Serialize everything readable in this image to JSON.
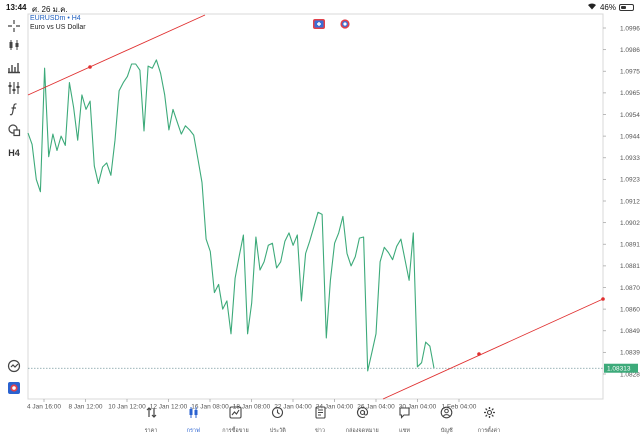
{
  "status_bar": {
    "time": "13:44",
    "date": "ศ. 26 ม.ค.",
    "battery_text": "46%",
    "battery_level": 0.46
  },
  "left_toolbar": [
    {
      "name": "crosshair-icon"
    },
    {
      "name": "candlestick-type-icon"
    },
    {
      "name": "bar-chart-icon"
    },
    {
      "name": "indicators-icon"
    },
    {
      "name": "function-icon"
    },
    {
      "name": "shapes-icon"
    },
    {
      "name": "timeframe-label",
      "text": "H4"
    }
  ],
  "chart_header": {
    "symbol": "EURUSDm",
    "timeframe": "H4",
    "symbol_line": "EURUSDm • H4",
    "description": "Euro vs US Dollar"
  },
  "trade_buttons": [
    {
      "name": "sell-flag-icon",
      "color": "#e0404a"
    },
    {
      "name": "buy-flag-icon",
      "color": "#3b6fd6"
    }
  ],
  "chart_data": {
    "type": "line",
    "title": "",
    "y_ticks": [
      "1.09965",
      "1.09860",
      "1.09755",
      "1.09650",
      "1.09545",
      "1.09440",
      "1.09335",
      "1.09230",
      "1.09125",
      "1.09020",
      "1.08915",
      "1.08810",
      "1.08705",
      "1.08600",
      "1.08495",
      "1.08390",
      "1.08285"
    ],
    "x_ticks": [
      "4 Jan 16:00",
      "8 Jan 12:00",
      "10 Jan 12:00",
      "12 Jan 12:00",
      "16 Jan 08:00",
      "18 Jan 08:00",
      "22 Jan 04:00",
      "24 Jan 04:00",
      "26 Jan 04:00",
      "30 Jan 04:00",
      "1 Feb 04:00"
    ],
    "ylim": [
      1.08285,
      1.09965
    ],
    "current_price": "1.08313",
    "current_price_value": 1.08313,
    "series": [
      {
        "color": "#3daa7a",
        "values": [
          1.09455,
          1.094,
          1.0923,
          1.0917,
          1.0977,
          1.0934,
          1.0945,
          1.0937,
          1.0944,
          1.09395,
          1.097,
          1.0958,
          1.0942,
          1.0964,
          1.0957,
          1.0961,
          1.09295,
          1.0921,
          1.0929,
          1.0931,
          1.0925,
          1.0942,
          1.0966,
          1.097,
          1.0973,
          1.0979,
          1.0979,
          1.0976,
          1.09465,
          1.0978,
          1.0977,
          1.0981,
          1.09745,
          1.0964,
          1.0947,
          1.0957,
          1.0951,
          1.0945,
          1.0949,
          1.0947,
          1.09445,
          1.0933,
          1.09215,
          1.0894,
          1.0888,
          1.0868,
          1.0872,
          1.086,
          1.0864,
          1.0848,
          1.0875,
          1.0886,
          1.0896,
          1.0848,
          1.0863,
          1.0895,
          1.0879,
          1.0883,
          1.0891,
          1.0892,
          1.088,
          1.0883,
          1.0893,
          1.0897,
          1.0891,
          1.0896,
          1.0864,
          1.0887,
          1.0893,
          1.09,
          1.0907,
          1.0906,
          1.0846,
          1.0874,
          1.0892,
          1.0897,
          1.0905,
          1.0887,
          1.0881,
          1.08855,
          1.08945,
          1.0895,
          1.083,
          1.0839,
          1.0848,
          1.0883,
          1.089,
          1.08875,
          1.0884,
          1.08905,
          1.0894,
          1.0884,
          1.0874,
          1.0897,
          1.0832,
          1.0834,
          1.0844,
          1.0842,
          1.08313
        ]
      }
    ],
    "trendlines": [
      {
        "color": "#e03030",
        "label": "upper-trendline"
      },
      {
        "color": "#e03030",
        "label": "lower-trendline"
      }
    ]
  },
  "bottom_nav": [
    {
      "name": "nav-quotes",
      "icon": "quotes-arrows-icon",
      "label": "ราคา",
      "active": false
    },
    {
      "name": "nav-chart",
      "icon": "candles-icon",
      "label": "กราฟ",
      "active": true
    },
    {
      "name": "nav-trade",
      "icon": "trade-chart-icon",
      "label": "การซื้อขาย",
      "active": false
    },
    {
      "name": "nav-history",
      "icon": "history-clock-icon",
      "label": "ประวัติ",
      "active": false
    },
    {
      "name": "nav-news",
      "icon": "news-icon",
      "label": "ข่าว",
      "active": false
    },
    {
      "name": "nav-mailbox",
      "icon": "at-sign-icon",
      "label": "กล่องจดหมาย",
      "active": false
    },
    {
      "name": "nav-chat",
      "icon": "chat-bubble-icon",
      "label": "แชท",
      "active": false
    },
    {
      "name": "nav-accounts",
      "icon": "account-user-icon",
      "label": "บัญชี",
      "active": false
    },
    {
      "name": "nav-settings",
      "icon": "gear-icon",
      "label": "การตั้งค่า",
      "active": false
    }
  ]
}
